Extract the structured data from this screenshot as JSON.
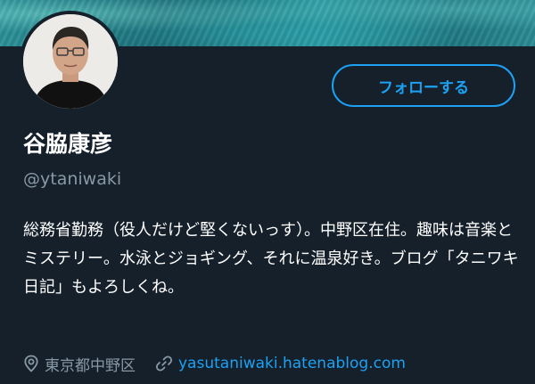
{
  "profile": {
    "display_name": "谷脇康彦",
    "handle": "@ytaniwaki",
    "bio": "総務省勤務（役人だけど堅くないっす）。中野区在住。趣味は音楽とミステリー。水泳とジョギング、それに温泉好き。ブログ「タニワキ日記」もよろしくね。",
    "location": "東京都中野区",
    "website": "yasutaniwaki.hatenablog.com"
  },
  "actions": {
    "follow_label": "フォローする"
  },
  "icons": {
    "location": "location-pin-icon",
    "link": "link-icon"
  },
  "colors": {
    "background": "#15202b",
    "accent": "#1da1f2",
    "secondary_text": "#8899a6"
  }
}
